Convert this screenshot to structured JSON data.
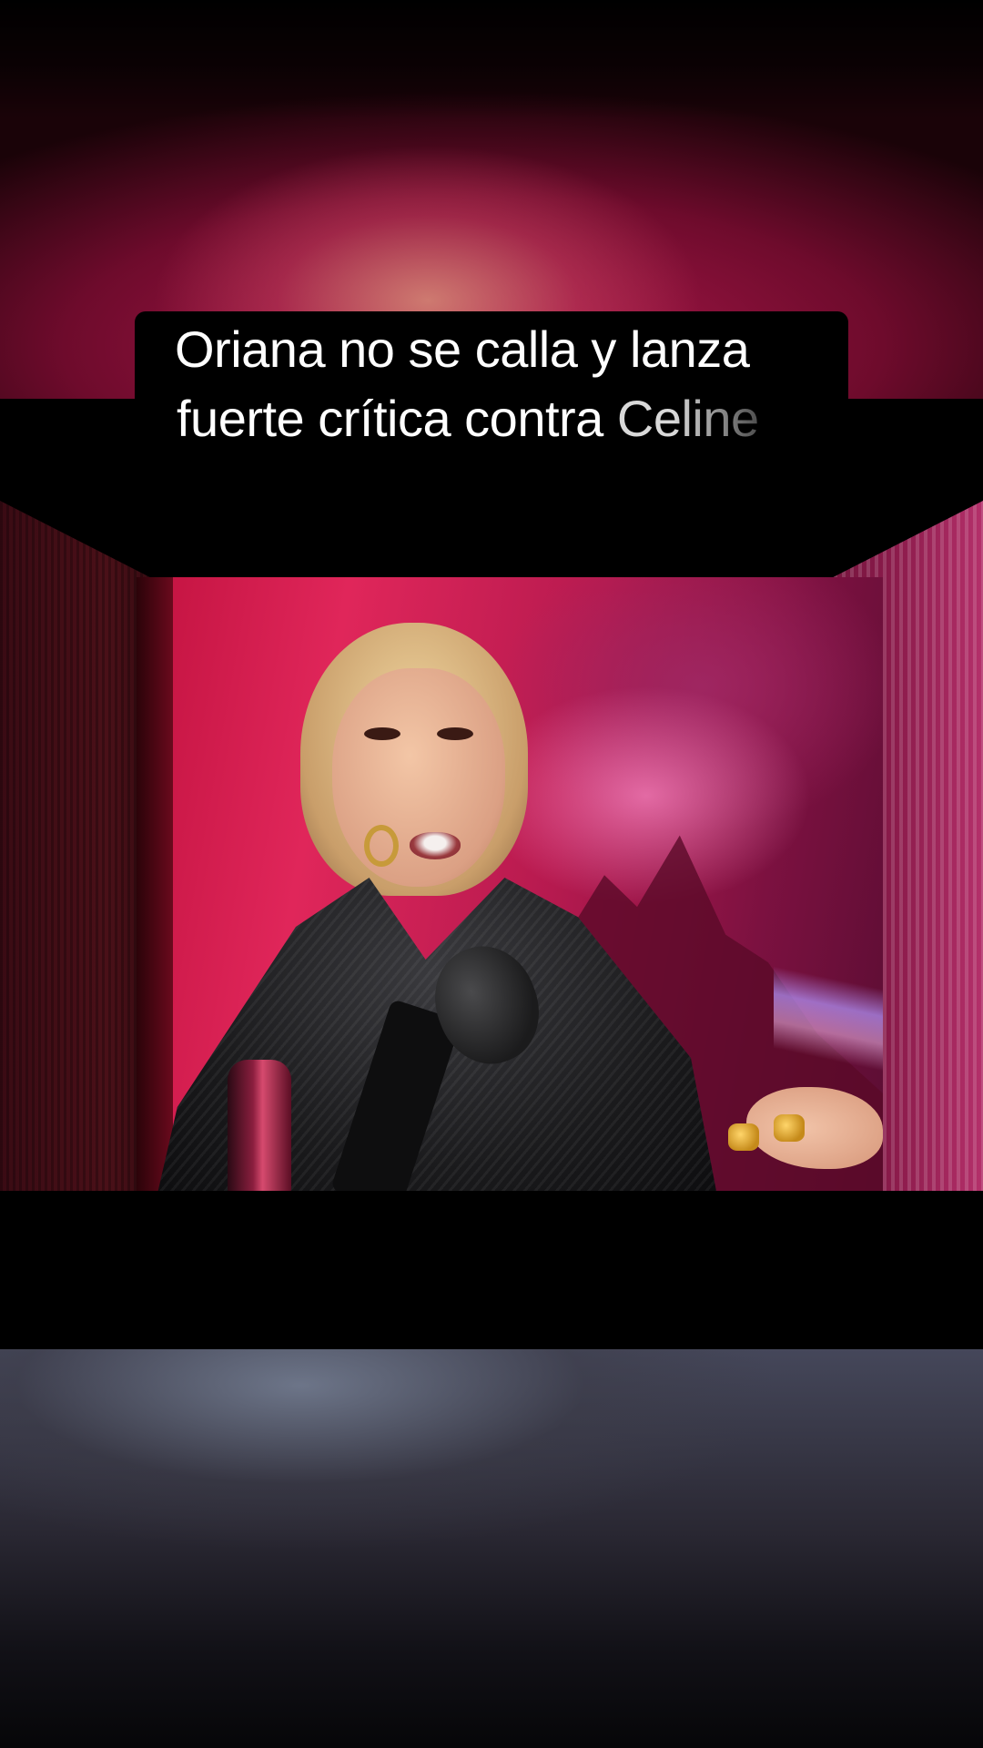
{
  "caption": {
    "line1": "Oriana no se calla y lanza",
    "line2_main": "fuerte crítica contra ",
    "line2_tail": "Celine"
  },
  "colors": {
    "caption_bg": "#000000",
    "caption_text": "#ffffff",
    "accent_pink": "#e0265a",
    "backdrop_magenta": "#b0184d"
  }
}
